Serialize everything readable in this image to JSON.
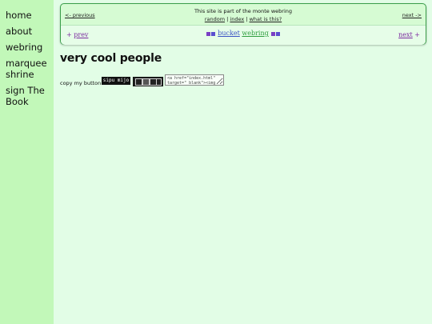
{
  "sidebar": {
    "items": [
      {
        "label": "home"
      },
      {
        "label": "about"
      },
      {
        "label": "webring"
      },
      {
        "label": "marquee shrine"
      },
      {
        "label": "sign The Book"
      }
    ]
  },
  "monte_ring": {
    "prev": "<- previous",
    "part_of": "This site is part of the monte webring",
    "random": "random",
    "sep": "|",
    "index": "index",
    "what": "what is this?",
    "next": "next ->"
  },
  "bucket_ring": {
    "prev_arrow": "+",
    "prev": "prev",
    "bucket": "bucket",
    "webring": "webring",
    "next": "next",
    "next_arrow": "+"
  },
  "page": {
    "title": "very cool people",
    "copy_label": "copy my button!",
    "badge1_text": "sipu mijo",
    "code": "<a href=\"index.html\"\ntarget=\"_blank\"><img"
  },
  "colors": {
    "sidebar_bg": "#c2f8b9",
    "page_bg": "#e2fde6",
    "ring_border": "#3a9e4a",
    "link_purple": "#7c2ba0"
  }
}
